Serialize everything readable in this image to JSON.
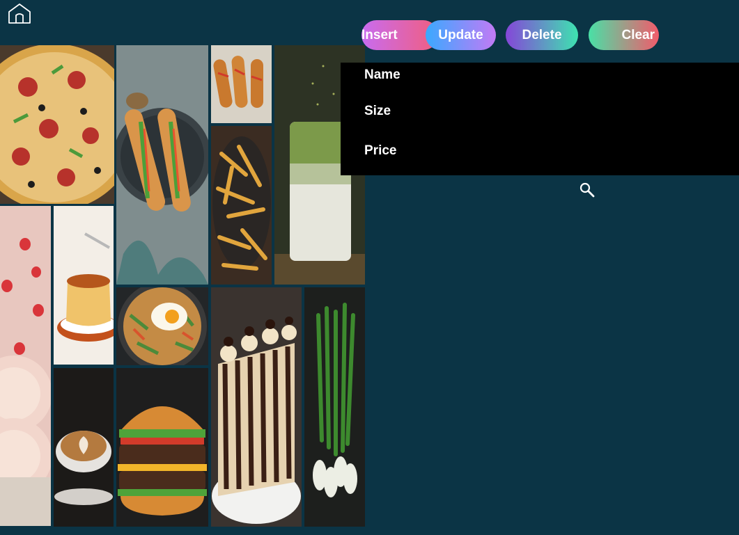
{
  "toolbar": {
    "insert_label": "Insert",
    "update_label": "Update",
    "delete_label": "Delete",
    "clear_label": "Clear"
  },
  "form": {
    "name_label": "Name",
    "size_label": "Size",
    "price_label": "Price",
    "name_value": "",
    "size_value": "",
    "price_value": ""
  },
  "icons": {
    "home": "home-icon",
    "search": "search-icon"
  },
  "colors": {
    "background": "#0b3445",
    "panel": "#000000",
    "text": "#ffffff"
  },
  "gallery": [
    "pizza-photo",
    "banh-mi-photo",
    "corn-dogs-photo",
    "matcha-latte-photo",
    "fries-photo",
    "strawberry-roll-cake-photo",
    "flan-photo",
    "bibimbap-photo",
    "chocolate-cake-photo",
    "spring-onions-photo",
    "latte-art-photo",
    "burger-photo"
  ]
}
